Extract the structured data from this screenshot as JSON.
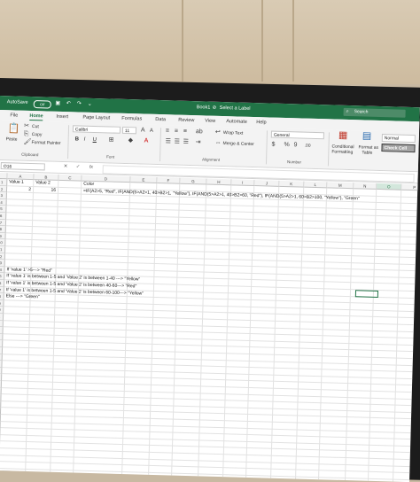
{
  "titlebar": {
    "autosave": "AutoSave",
    "autosave_state": "Off",
    "doc_title": "Book1",
    "select_label": "Select a Label",
    "search": "Search"
  },
  "tabs": [
    "File",
    "Home",
    "Insert",
    "Page Layout",
    "Formulas",
    "Data",
    "Review",
    "View",
    "Automate",
    "Help"
  ],
  "ribbon": {
    "clipboard": {
      "paste": "Paste",
      "cut": "Cut",
      "copy": "Copy",
      "format_painter": "Format Painter",
      "label": "Clipboard"
    },
    "font": {
      "name": "Calibri",
      "size": "11",
      "bold": "B",
      "italic": "I",
      "underline": "U",
      "label": "Font"
    },
    "alignment": {
      "wrap_text": "Wrap Text",
      "merge_center": "Merge & Center",
      "label": "Alignment"
    },
    "number": {
      "format": "General",
      "label": "Number"
    },
    "styles": {
      "conditional": "Conditional",
      "formatting": "Formatting",
      "format_as": "Format as",
      "table": "Table",
      "normal": "Normal",
      "check_cell": "Check Cell"
    }
  },
  "formula_bar": {
    "name_box": "O16",
    "fx": "fx",
    "content": ""
  },
  "columns": [
    "A",
    "B",
    "C",
    "D",
    "E",
    "F",
    "G",
    "H",
    "I",
    "J",
    "K",
    "L",
    "M",
    "N",
    "O",
    "P"
  ],
  "selected_column": "O",
  "rows": [
    "1",
    "2",
    "3",
    "4",
    "5",
    "6",
    "7",
    "8",
    "9",
    "10",
    "11",
    "12",
    "13",
    "14",
    "15",
    "16",
    "17",
    "18",
    "19",
    "20",
    "21",
    "22",
    "23",
    "24",
    "25",
    "26",
    "27",
    "28",
    "29",
    "30",
    "31",
    "32",
    "33",
    "34",
    "35",
    "36",
    "37",
    "38",
    "39",
    "40",
    "41",
    "42",
    "43"
  ],
  "cells": {
    "A1": "Value 1",
    "B1": "Value 2",
    "D1": "Color",
    "A2": "2",
    "B2": "16",
    "D2": "=IF(A2>5, \"Red\", IF(AND(5>A2>1, 40>B2>1, \"Yellow\"), IF(AND(5>A2>1, 40>B2>60, \"Red\"), IF(AND(5>A2>1, 60>B2>100, \"Yellow\"), \"Green\"",
    "A14": "If 'value 1' >5---> \"Red\"",
    "A15": "If 'value 1' is between 1-5 and 'Value 2' is between 1-40 ---> \"Yellow\"",
    "A16": "If 'value 1' is between 1-5 and 'Value 2' is between 40-60---> \"Red\"",
    "A17": "If 'value 1' is between 1-5 and 'Value 2' is between 60-100---> \"Yellow\"",
    "A18": "Else ---> \"Green\""
  },
  "colors": {
    "excel_green": "#217346",
    "ribbon_bg": "#f3f3f3",
    "selected_header": "#d3e7dc"
  }
}
